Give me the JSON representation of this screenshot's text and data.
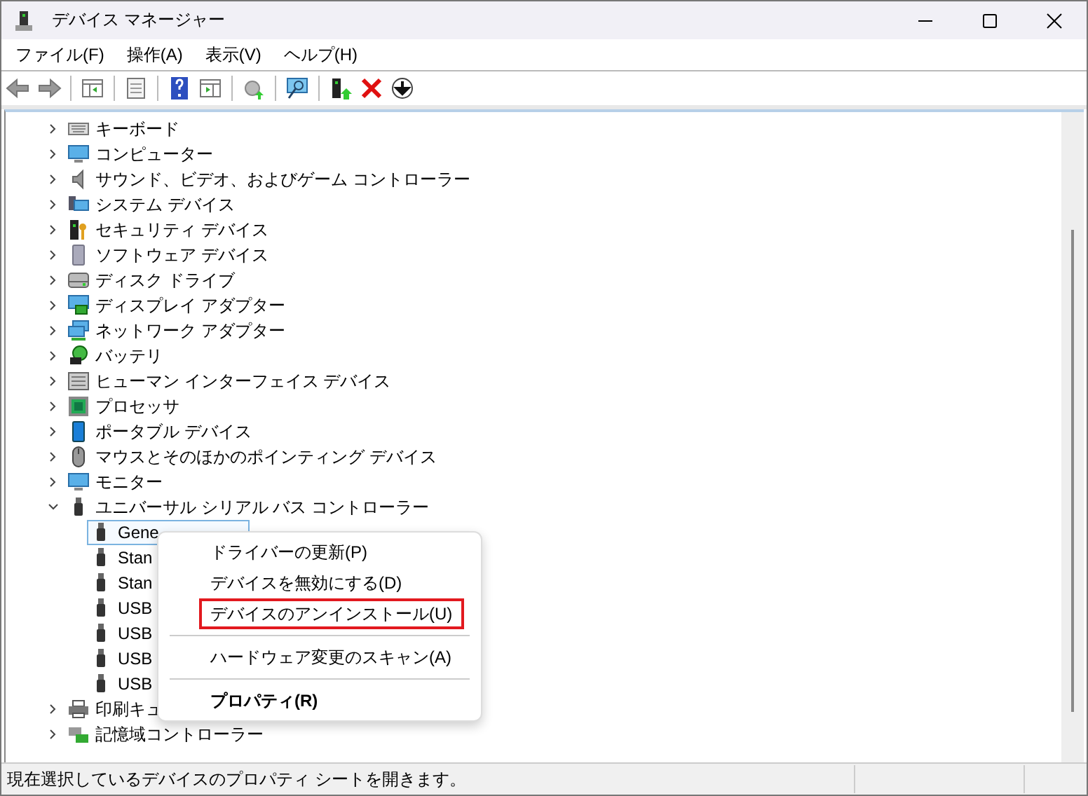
{
  "window": {
    "title": "デバイス マネージャー"
  },
  "menu": [
    "ファイル(F)",
    "操作(A)",
    "表示(V)",
    "ヘルプ(H)"
  ],
  "tree": [
    {
      "label": "キーボード",
      "expanded": false
    },
    {
      "label": "コンピューター",
      "expanded": false
    },
    {
      "label": "サウンド、ビデオ、およびゲーム コントローラー",
      "expanded": false
    },
    {
      "label": "システム デバイス",
      "expanded": false
    },
    {
      "label": "セキュリティ デバイス",
      "expanded": false
    },
    {
      "label": "ソフトウェア デバイス",
      "expanded": false
    },
    {
      "label": "ディスク ドライブ",
      "expanded": false
    },
    {
      "label": "ディスプレイ アダプター",
      "expanded": false
    },
    {
      "label": "ネットワーク アダプター",
      "expanded": false
    },
    {
      "label": "バッテリ",
      "expanded": false
    },
    {
      "label": "ヒューマン インターフェイス デバイス",
      "expanded": false
    },
    {
      "label": "プロセッサ",
      "expanded": false
    },
    {
      "label": "ポータブル デバイス",
      "expanded": false
    },
    {
      "label": "マウスとそのほかのポインティング デバイス",
      "expanded": false
    },
    {
      "label": "モニター",
      "expanded": false
    },
    {
      "label": "ユニバーサル シリアル バス コントローラー",
      "expanded": true,
      "children": [
        {
          "label": "Gene",
          "selected": true
        },
        {
          "label": "Stan",
          "selected": false
        },
        {
          "label": "Stan",
          "selected": false
        },
        {
          "label": "USB",
          "selected": false
        },
        {
          "label": "USB",
          "selected": false
        },
        {
          "label": "USB",
          "selected": false
        },
        {
          "label": "USB",
          "selected": false
        }
      ]
    },
    {
      "label": "印刷キュ",
      "expanded": false
    },
    {
      "label": "記憶域コントローラー",
      "expanded": false
    }
  ],
  "context_menu": [
    {
      "kind": "item",
      "label": "ドライバーの更新(P)",
      "bold": false,
      "outlined": false
    },
    {
      "kind": "item",
      "label": "デバイスを無効にする(D)",
      "bold": false,
      "outlined": false
    },
    {
      "kind": "item",
      "label": "デバイスのアンインストール(U)",
      "bold": false,
      "outlined": true
    },
    {
      "kind": "separator"
    },
    {
      "kind": "item",
      "label": "ハードウェア変更のスキャン(A)",
      "bold": false,
      "outlined": false
    },
    {
      "kind": "separator"
    },
    {
      "kind": "item",
      "label": "プロパティ(R)",
      "bold": true,
      "outlined": false
    }
  ],
  "status_bar": {
    "text": "現在選択しているデバイスのプロパティ シートを開きます。"
  }
}
